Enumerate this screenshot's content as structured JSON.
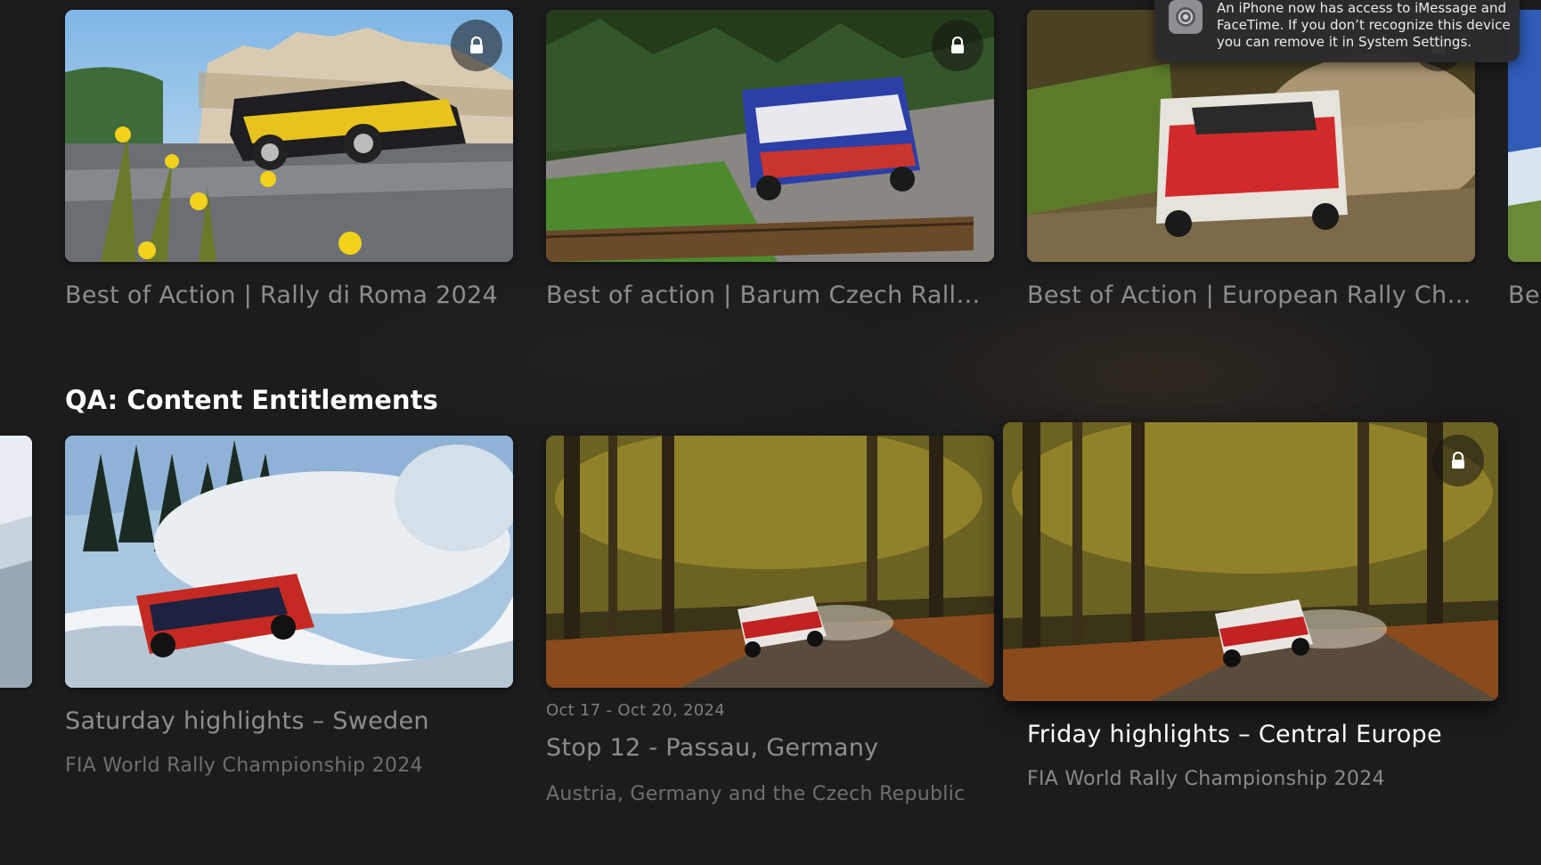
{
  "rows": [
    {
      "items": [
        {
          "title": "Best of Action | Rally di Roma 2024",
          "locked": true
        },
        {
          "title": "Best of action | Barum Czech Rally Z...",
          "locked": true
        },
        {
          "title": "Best of Action | European Rally Cha...",
          "locked": true
        },
        {
          "title": "Be"
        }
      ]
    },
    {
      "section_title": "QA: Content Entitlements",
      "items": [
        {
          "title": "Saturday highlights – Sweden",
          "subtitle": "FIA World Rally Championship 2024",
          "locked": false
        },
        {
          "date": "Oct 17 - Oct 20, 2024",
          "title": "Stop 12 - Passau, Germany",
          "subtitle": "Austria, Germany and the Czech Republic",
          "locked": false
        },
        {
          "title": "Friday highlights – Central Europe",
          "subtitle": "FIA World Rally Championship 2024",
          "locked": true,
          "focused": true
        }
      ]
    }
  ],
  "notification": {
    "text": "An iPhone now has access to iMessage and FaceTime. If you don’t recognize this device you can remove it in System Settings.",
    "icon": "system-settings-icon"
  },
  "colors": {
    "background": "#1c1c1e",
    "title_dim": "#8d8d8d",
    "title_focused": "#ffffff"
  }
}
